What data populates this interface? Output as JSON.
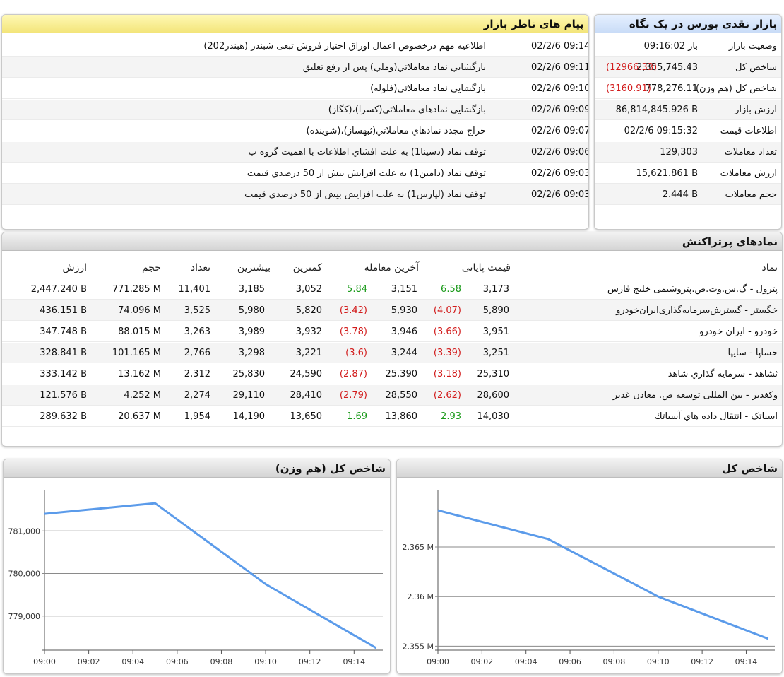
{
  "glance": {
    "title": "بازار نقدی بورس در یک نگاه",
    "rows": [
      {
        "label": "وضعیت بازار",
        "value": "باز 09:16:02",
        "change": ""
      },
      {
        "label": "شاخص کل",
        "value": "2,355,745.43",
        "change": "(12966.33)"
      },
      {
        "label": "شاخص کل (هم وزن)",
        "value": "778,276.11",
        "change": "(3160.91)"
      },
      {
        "label": "ارزش بازار",
        "value": "86,814,845.926 B",
        "change": ""
      },
      {
        "label": "اطلاعات قیمت",
        "value": "02/2/6 09:15:32",
        "change": ""
      },
      {
        "label": "تعداد معاملات",
        "value": "129,303",
        "change": ""
      },
      {
        "label": "ارزش معاملات",
        "value": "15,621.861 B",
        "change": ""
      },
      {
        "label": "حجم معاملات",
        "value": "2.444 B",
        "change": ""
      }
    ]
  },
  "messages": {
    "title": "پیام های ناظر بازار",
    "rows": [
      {
        "time": "02/2/6 09:14",
        "text": "اطلاعیه مهم درخصوص اعمال اوراق اختیار فروش تبعی شبندر (هبندر202)"
      },
      {
        "time": "02/2/6 09:11",
        "text": "بازگشايي نماد معاملاتي(وملي) پس از رفع تعليق"
      },
      {
        "time": "02/2/6 09:10",
        "text": "بازگشايي نماد معاملاتي(فلوله)"
      },
      {
        "time": "02/2/6 09:09",
        "text": "بازگشايي نمادهاي معاملاتي(كسرا)،(كگاز)"
      },
      {
        "time": "02/2/6 09:07",
        "text": "حراج مجدد نمادهاي معاملاتي(ثبهساز)،(شوينده)"
      },
      {
        "time": "02/2/6 09:06",
        "text": "توقف نماد (دسينا1) به علت افشاي اطلاعات با اهميت گروه ب"
      },
      {
        "time": "02/2/6 09:03",
        "text": "توقف نماد (دامين1) به علت افزايش بيش از 50 درصدي قيمت"
      },
      {
        "time": "02/2/6 09:03",
        "text": "توقف نماد (لپارس1) به علت افزايش بيش از 50 درصدي قيمت"
      }
    ]
  },
  "symbols": {
    "title": "نمادهای پرتراکنش",
    "headers": {
      "symbol": "نماد",
      "closing": "قیمت پایانی",
      "last": "آخرین معامله",
      "low": "کمترین",
      "high": "بیشترین",
      "count": "تعداد",
      "volume": "حجم",
      "value": "ارزش"
    },
    "rows": [
      {
        "symbol": "پترول - گ.س.وت.ص.پتروشیمی خلیج فارس",
        "closing": "3,173",
        "closing_change": "6.58",
        "closing_dir": "pos",
        "last": "3,151",
        "last_change": "5.84",
        "last_dir": "pos",
        "low": "3,052",
        "high": "3,185",
        "count": "11,401",
        "volume": "771.285 M",
        "value": "2,447.240 B"
      },
      {
        "symbol": "خگستر - گسترش‌سرمایه‌گذاری‌ایران‌خودرو",
        "closing": "5,890",
        "closing_change": "(4.07)",
        "closing_dir": "neg",
        "last": "5,930",
        "last_change": "(3.42)",
        "last_dir": "neg",
        "low": "5,820",
        "high": "5,980",
        "count": "3,525",
        "volume": "74.096 M",
        "value": "436.151 B"
      },
      {
        "symbol": "خودرو - ایران‌ خودرو",
        "closing": "3,951",
        "closing_change": "(3.66)",
        "closing_dir": "neg",
        "last": "3,946",
        "last_change": "(3.78)",
        "last_dir": "neg",
        "low": "3,932",
        "high": "3,989",
        "count": "3,263",
        "volume": "88.015 M",
        "value": "347.748 B"
      },
      {
        "symbol": "خساپا - سایپا",
        "closing": "3,251",
        "closing_change": "(3.39)",
        "closing_dir": "neg",
        "last": "3,244",
        "last_change": "(3.6)",
        "last_dir": "neg",
        "low": "3,221",
        "high": "3,298",
        "count": "2,766",
        "volume": "101.165 M",
        "value": "328.841 B"
      },
      {
        "symbol": "ثشاهد - سرمایه گذاري شاهد",
        "closing": "25,310",
        "closing_change": "(3.18)",
        "closing_dir": "neg",
        "last": "25,390",
        "last_change": "(2.87)",
        "last_dir": "neg",
        "low": "24,590",
        "high": "25,830",
        "count": "2,312",
        "volume": "13.162 M",
        "value": "333.142 B"
      },
      {
        "symbol": "وکغدیر - بین المللی توسعه ص. معادن غدیر",
        "closing": "28,600",
        "closing_change": "(2.62)",
        "closing_dir": "neg",
        "last": "28,550",
        "last_change": "(2.79)",
        "last_dir": "neg",
        "low": "28,410",
        "high": "29,110",
        "count": "2,274",
        "volume": "4.252 M",
        "value": "121.576 B"
      },
      {
        "symbol": "اسیاتک - انتقال داده هاي آسياتك",
        "closing": "14,030",
        "closing_change": "2.93",
        "closing_dir": "pos",
        "last": "13,860",
        "last_change": "1.69",
        "last_dir": "pos",
        "low": "13,650",
        "high": "14,190",
        "count": "1,954",
        "volume": "20.637 M",
        "value": "289.632 B"
      }
    ]
  },
  "colors": {
    "line": "#5b9bea",
    "negative": "#d21b1b",
    "positive": "#1a9a1a"
  },
  "chart_data": [
    {
      "type": "line",
      "title": "شاخص کل (هم وزن)",
      "x": [
        "09:00",
        "09:05",
        "09:10",
        "09:15"
      ],
      "values": [
        781400,
        781650,
        779750,
        778250
      ],
      "ticks_x": [
        "09:00",
        "09:02",
        "09:04",
        "09:06",
        "09:08",
        "09:10",
        "09:12",
        "09:14"
      ],
      "ticks_y": [
        {
          "v": 781000,
          "label": "781,000"
        },
        {
          "v": 780000,
          "label": "780,000"
        },
        {
          "v": 779000,
          "label": "779,000"
        }
      ],
      "ylim": [
        778200,
        781950
      ],
      "grid": true
    },
    {
      "type": "line",
      "title": "شاخص کل",
      "x": [
        "09:00",
        "09:05",
        "09:10",
        "09:15"
      ],
      "values": [
        2368700,
        2365800,
        2360000,
        2355745
      ],
      "ticks_x": [
        "09:00",
        "09:02",
        "09:04",
        "09:06",
        "09:08",
        "09:10",
        "09:12",
        "09:14"
      ],
      "ticks_y": [
        {
          "v": 2365000,
          "label": "2.365 M"
        },
        {
          "v": 2360000,
          "label": "2.36 M"
        },
        {
          "v": 2355000,
          "label": "2.355 M"
        }
      ],
      "ylim": [
        2354600,
        2370700
      ],
      "grid": true
    }
  ]
}
